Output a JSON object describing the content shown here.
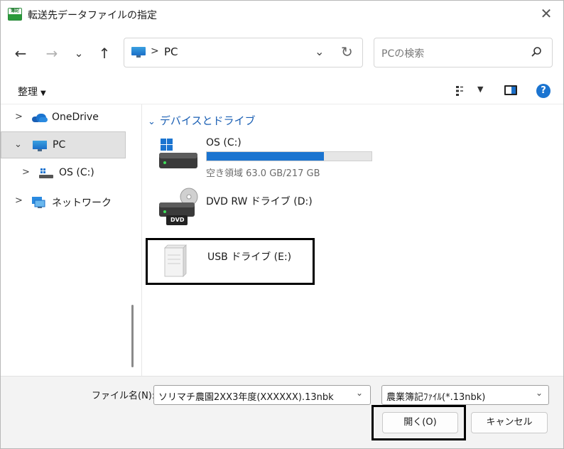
{
  "title": "転送先データファイルの指定",
  "app_icon_text": "簿記",
  "address": {
    "separator": ">",
    "location": "PC"
  },
  "search": {
    "placeholder": "PCの検索"
  },
  "commandbar": {
    "organize": "整理"
  },
  "navpane": {
    "items": [
      {
        "label": "OneDrive"
      },
      {
        "label": "PC"
      },
      {
        "label": "OS (C:)"
      },
      {
        "label": "ネットワーク"
      }
    ]
  },
  "content": {
    "group": "デバイスとドライブ",
    "drives": [
      {
        "name": "OS (C:)",
        "free": "空き領域 63.0 GB/217 GB",
        "used_fraction": 0.71
      },
      {
        "name": "DVD RW ドライブ (D:)",
        "badge": "DVD"
      },
      {
        "name": "USB ドライブ (E:)"
      }
    ]
  },
  "bottom": {
    "filename_label": "ファイル名(N):",
    "filename_value": "ソリマチ農園2XX3年度(XXXXXX).13nbk",
    "filetype_value": "農業簿記ﾌｧｲﾙ(*.13nbk)",
    "open_label": "開く(O)",
    "cancel_label": "キャンセル"
  },
  "colors": {
    "accent": "#1b74d0",
    "group_header": "#1a5fb4"
  }
}
